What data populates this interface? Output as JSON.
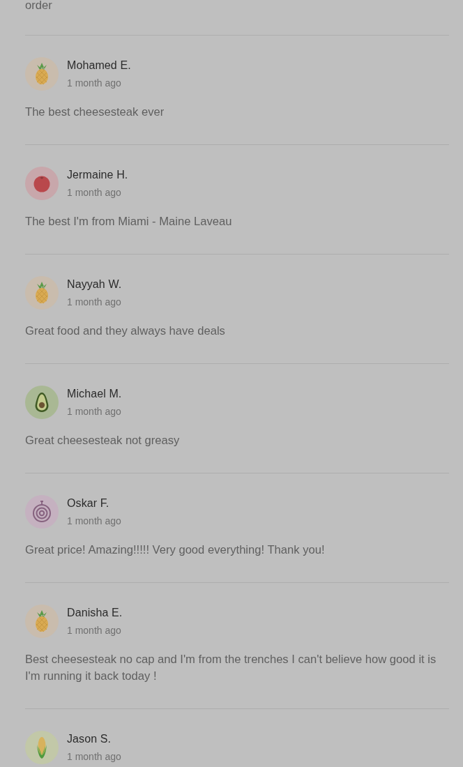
{
  "previous_review_tail": "order",
  "reviews": [
    {
      "name": "Mohamed E.",
      "time": "1 month ago",
      "avatar": {
        "kind": "pineapple"
      },
      "text": "The best cheesesteak ever"
    },
    {
      "name": "Jermaine H.",
      "time": "1 month ago",
      "avatar": {
        "kind": "tomato"
      },
      "text": "The best I'm from Miami - Maine Laveau"
    },
    {
      "name": "Nayyah W.",
      "time": "1 month ago",
      "avatar": {
        "kind": "pineapple"
      },
      "text": "Great food and they always have deals"
    },
    {
      "name": "Michael M.",
      "time": "1 month ago",
      "avatar": {
        "kind": "avocado"
      },
      "text": "Great cheesesteak not greasy"
    },
    {
      "name": "Oskar F.",
      "time": "1 month ago",
      "avatar": {
        "kind": "onion"
      },
      "text": "Great price! Amazing!!!!! Very good everything! Thank you!"
    },
    {
      "name": "Danisha E.",
      "time": "1 month ago",
      "avatar": {
        "kind": "pineapple"
      },
      "text": "Best cheesesteak no cap and I'm from the trenches I can't believe how good it is I'm running it back today !"
    },
    {
      "name": "Jason S.",
      "time": "1 month ago",
      "avatar": {
        "kind": "corn"
      }
    }
  ]
}
